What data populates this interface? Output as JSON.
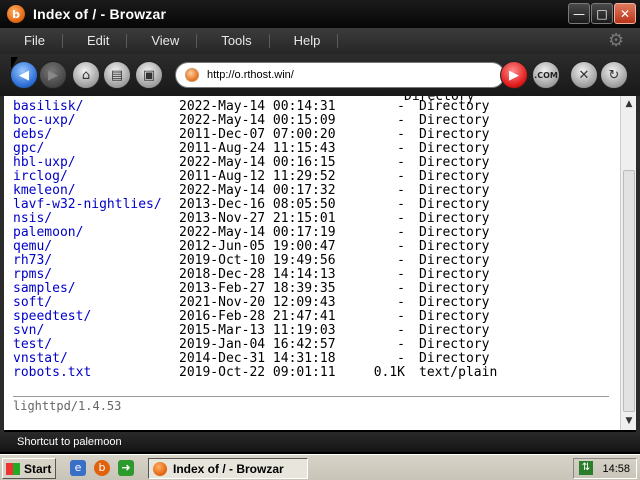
{
  "window": {
    "title": "Index of / - Browzar",
    "controls": {
      "minimize": "—",
      "maximize": "□",
      "close": "✕"
    }
  },
  "menu": [
    "File",
    "Edit",
    "View",
    "Tools",
    "Help"
  ],
  "toolbar": {
    "address": "http://o.rthost.win/",
    "com_label": ".COM"
  },
  "listing": {
    "clipped_top_text": "Directory",
    "entries": [
      {
        "name": "basilisk/",
        "date": "2022-May-14 00:14:31",
        "size": "-",
        "type": "Directory"
      },
      {
        "name": "boc-uxp/",
        "date": "2022-May-14 00:15:09",
        "size": "-",
        "type": "Directory"
      },
      {
        "name": "debs/",
        "date": "2011-Dec-07 07:00:20",
        "size": "-",
        "type": "Directory"
      },
      {
        "name": "gpc/",
        "date": "2011-Aug-24 11:15:43",
        "size": "-",
        "type": "Directory"
      },
      {
        "name": "hbl-uxp/",
        "date": "2022-May-14 00:16:15",
        "size": "-",
        "type": "Directory"
      },
      {
        "name": "irclog/",
        "date": "2011-Aug-12 11:29:52",
        "size": "-",
        "type": "Directory"
      },
      {
        "name": "kmeleon/",
        "date": "2022-May-14 00:17:32",
        "size": "-",
        "type": "Directory"
      },
      {
        "name": "lavf-w32-nightlies/",
        "date": "2013-Dec-16 08:05:50",
        "size": "-",
        "type": "Directory"
      },
      {
        "name": "nsis/",
        "date": "2013-Nov-27 21:15:01",
        "size": "-",
        "type": "Directory"
      },
      {
        "name": "palemoon/",
        "date": "2022-May-14 00:17:19",
        "size": "-",
        "type": "Directory"
      },
      {
        "name": "qemu/",
        "date": "2012-Jun-05 19:00:47",
        "size": "-",
        "type": "Directory"
      },
      {
        "name": "rh73/",
        "date": "2019-Oct-10 19:49:56",
        "size": "-",
        "type": "Directory"
      },
      {
        "name": "rpms/",
        "date": "2018-Dec-28 14:14:13",
        "size": "-",
        "type": "Directory"
      },
      {
        "name": "samples/",
        "date": "2013-Feb-27 18:39:35",
        "size": "-",
        "type": "Directory"
      },
      {
        "name": "soft/",
        "date": "2021-Nov-20 12:09:43",
        "size": "-",
        "type": "Directory"
      },
      {
        "name": "speedtest/",
        "date": "2016-Feb-28 21:47:41",
        "size": "-",
        "type": "Directory"
      },
      {
        "name": "svn/",
        "date": "2015-Mar-13 11:19:03",
        "size": "-",
        "type": "Directory"
      },
      {
        "name": "test/",
        "date": "2019-Jan-04 16:42:57",
        "size": "-",
        "type": "Directory"
      },
      {
        "name": "vnstat/",
        "date": "2014-Dec-31 14:31:18",
        "size": "-",
        "type": "Directory"
      },
      {
        "name": "robots.txt",
        "date": "2019-Oct-22 09:01:11",
        "size": "0.1K",
        "type": "text/plain"
      }
    ],
    "server": "lighttpd/1.4.53"
  },
  "status": "Shortcut to palemoon",
  "taskbar": {
    "start": "Start",
    "task": "Index of / - Browzar",
    "clock": "14:58"
  },
  "colors": {
    "link": "#0000c8",
    "chrome": "#1e1e1e",
    "accent_orange": "#e0620c"
  }
}
